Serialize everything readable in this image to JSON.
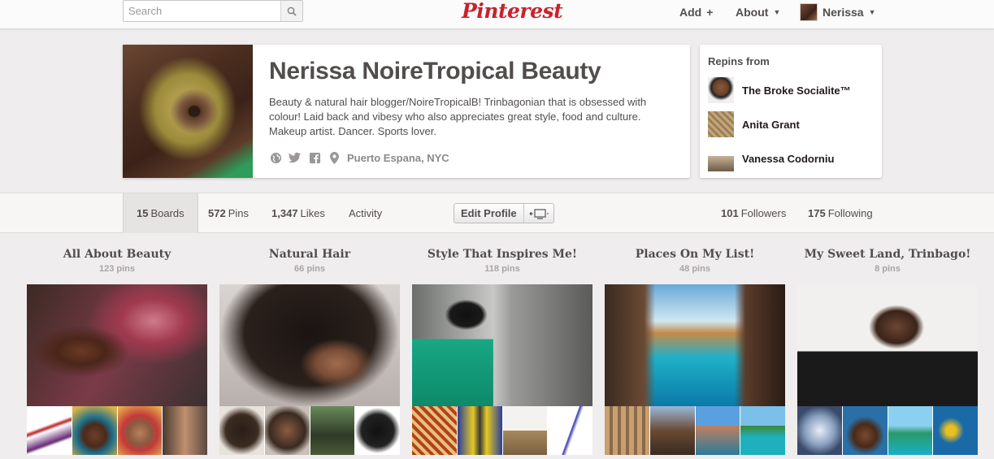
{
  "header": {
    "search_placeholder": "Search",
    "logo": "Pinterest",
    "add_label": "Add",
    "add_icon": "+",
    "about_label": "About",
    "user_name": "Nerissa"
  },
  "profile": {
    "name": "Nerissa NoireTropical Beauty",
    "bio": "Beauty & natural hair blogger/NoireTropicalB! Trinbagonian that is obsessed with colour! Laid back and vibesy who also appreciates great style, food and culture. Makeup artist. Dancer. Sports lover.",
    "location": "Puerto Espana, NYC"
  },
  "repins": {
    "title": "Repins from",
    "users": [
      {
        "name": "The Broke Socialite™"
      },
      {
        "name": "Anita Grant"
      },
      {
        "name": "Vanessa Codorniu"
      }
    ]
  },
  "stats": {
    "boards_count": "15",
    "boards_label": "Boards",
    "pins_count": "572",
    "pins_label": "Pins",
    "likes_count": "1,347",
    "likes_label": "Likes",
    "activity_label": "Activity",
    "edit_profile_label": "Edit Profile",
    "followers_count": "101",
    "followers_label": "Followers",
    "following_count": "175",
    "following_label": "Following"
  },
  "boards": [
    {
      "title": "All About Beauty",
      "count": "123 pins"
    },
    {
      "title": "Natural Hair",
      "count": "66 pins"
    },
    {
      "title": "Style That Inspires Me!",
      "count": "118 pins"
    },
    {
      "title": "Places On My List!",
      "count": "48 pins"
    },
    {
      "title": "My Sweet Land, Trinbago!",
      "count": "8 pins"
    }
  ],
  "colors": {
    "brand": "#c8232c",
    "text": "#524d4d",
    "muted": "#8c8888"
  }
}
